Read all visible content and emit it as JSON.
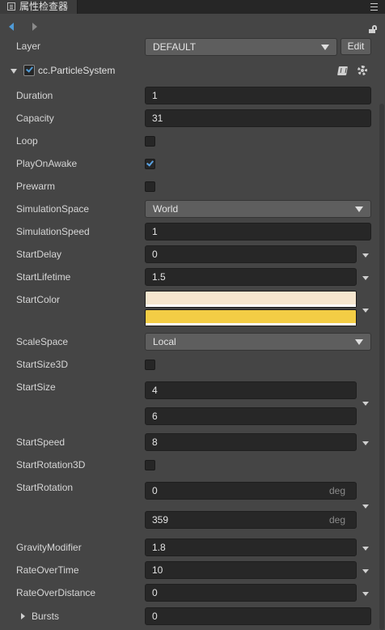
{
  "tab": {
    "title": "属性检查器",
    "icon": "inspector-icon",
    "menu_icon": "hamburger-menu-icon"
  },
  "nav": {
    "back_icon": "back-arrow-icon",
    "forward_icon": "forward-arrow-icon",
    "lock_icon": "lock-icon"
  },
  "layer": {
    "label": "Layer",
    "value": "DEFAULT",
    "edit_label": "Edit"
  },
  "component": {
    "title": "cc.ParticleSystem",
    "enabled": true,
    "doc_icon": "book-icon",
    "settings_icon": "gear-icon"
  },
  "props": {
    "duration": {
      "label": "Duration",
      "value": "1"
    },
    "capacity": {
      "label": "Capacity",
      "value": "31"
    },
    "loop": {
      "label": "Loop",
      "checked": false
    },
    "play_on_awake": {
      "label": "PlayOnAwake",
      "checked": true
    },
    "prewarm": {
      "label": "Prewarm",
      "checked": false
    },
    "simulation_space": {
      "label": "SimulationSpace",
      "value": "World"
    },
    "simulation_speed": {
      "label": "SimulationSpeed",
      "value": "1"
    },
    "start_delay": {
      "label": "StartDelay",
      "value": "0"
    },
    "start_lifetime": {
      "label": "StartLifetime",
      "value": "1.5"
    },
    "start_color": {
      "label": "StartColor",
      "colors": [
        "#f5e6cf",
        "#f3cd45"
      ]
    },
    "scale_space": {
      "label": "ScaleSpace",
      "value": "Local"
    },
    "start_size_3d": {
      "label": "StartSize3D",
      "checked": false
    },
    "start_size": {
      "label": "StartSize",
      "min": "4",
      "max": "6"
    },
    "start_speed": {
      "label": "StartSpeed",
      "value": "8"
    },
    "start_rotation_3d": {
      "label": "StartRotation3D",
      "checked": false
    },
    "start_rotation": {
      "label": "StartRotation",
      "min": "0",
      "max": "359",
      "unit": "deg"
    },
    "gravity_modifier": {
      "label": "GravityModifier",
      "value": "1.8"
    },
    "rate_over_time": {
      "label": "RateOverTime",
      "value": "10"
    },
    "rate_over_distance": {
      "label": "RateOverDistance",
      "value": "0"
    },
    "bursts": {
      "label": "Bursts",
      "value": "0"
    }
  },
  "colors": {
    "accent": "#4f9bd7",
    "field_bg": "#272727",
    "panel_bg": "#454545"
  }
}
